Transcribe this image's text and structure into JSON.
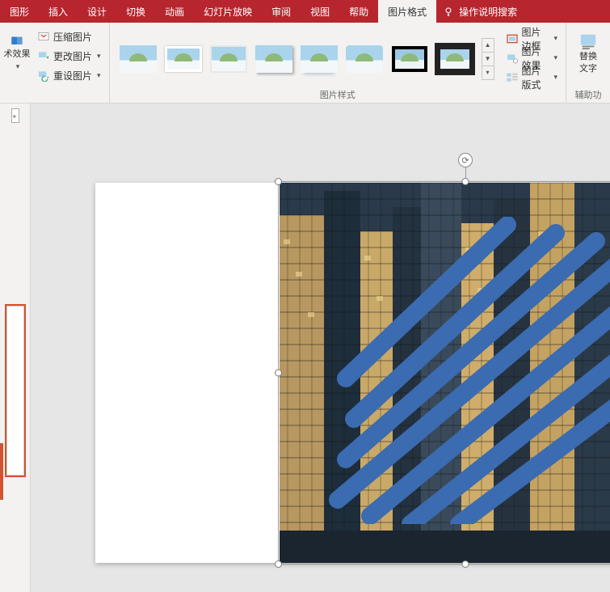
{
  "tabs": {
    "shape": "图形",
    "insert": "插入",
    "design": "设计",
    "transition": "切换",
    "animation": "动画",
    "slideshow": "幻灯片放映",
    "review": "审阅",
    "view": "视图",
    "help": "帮助",
    "picture_format": "图片格式",
    "tell_me": "操作说明搜索"
  },
  "adjust": {
    "art_effects": "术效果",
    "compress": "压缩图片",
    "change": "更改图片",
    "reset": "重设图片"
  },
  "picture_styles": {
    "group_label": "图片样式",
    "border": "图片边框",
    "effects": "图片效果",
    "layout": "图片版式"
  },
  "accessibility": {
    "alt_text_line1": "替换",
    "alt_text_line2": "文字",
    "group_label": "辅助功"
  }
}
